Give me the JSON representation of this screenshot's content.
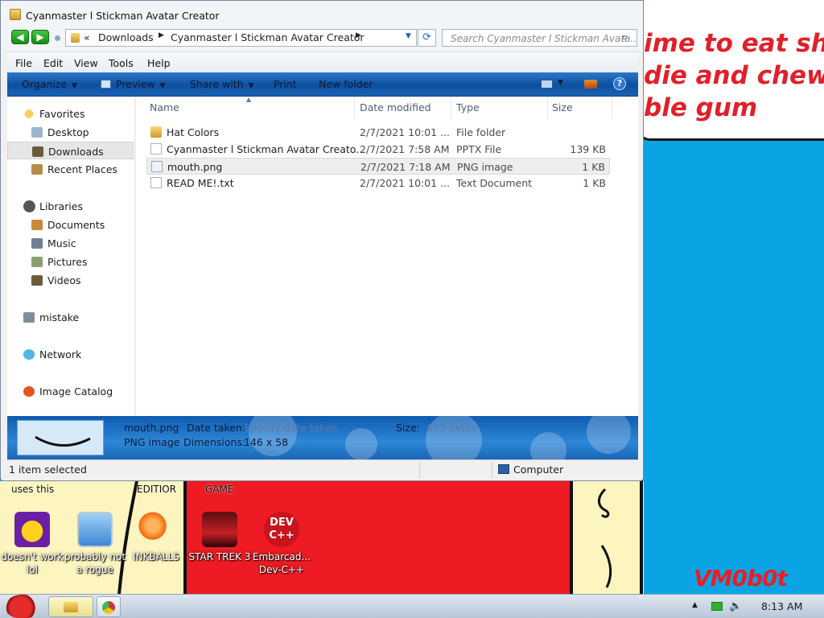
{
  "window": {
    "title": "Cyanmaster l Stickman Avatar Creator",
    "breadcrumb": [
      "Downloads",
      "Cyanmaster l Stickman Avatar Creator"
    ],
    "breadcrumb_prefix": "«",
    "search_placeholder": "Search Cyanmaster l Stickman Avata..."
  },
  "menubar": [
    "File",
    "Edit",
    "View",
    "Tools",
    "Help"
  ],
  "commandbar": {
    "organize": "Organize",
    "preview": "Preview",
    "share_with": "Share with",
    "print": "Print",
    "new_folder": "New folder"
  },
  "nav_pane": {
    "favorites": "Favorites",
    "desktop": "Desktop",
    "downloads": "Downloads",
    "recent_places": "Recent Places",
    "libraries": "Libraries",
    "documents": "Documents",
    "music": "Music",
    "pictures": "Pictures",
    "videos": "Videos",
    "mistake": "mistake",
    "network": "Network",
    "image_catalog": "Image Catalog"
  },
  "columns": {
    "name": "Name",
    "date_modified": "Date modified",
    "type": "Type",
    "size": "Size"
  },
  "files": [
    {
      "name": "Hat Colors",
      "date": "2/7/2021 10:01 ...",
      "type": "File folder",
      "size": ""
    },
    {
      "name": "Cyanmaster l Stickman Avatar Creato...",
      "date": "2/7/2021 7:58 AM",
      "type": "PPTX File",
      "size": "139 KB"
    },
    {
      "name": "mouth.png",
      "date": "2/7/2021 7:18 AM",
      "type": "PNG image",
      "size": "1 KB"
    },
    {
      "name": "READ ME!.txt",
      "date": "2/7/2021 10:01 ...",
      "type": "Text Document",
      "size": "1 KB"
    }
  ],
  "details": {
    "filename": "mouth.png",
    "date_taken_label": "Date taken:",
    "date_taken_value": "Specify date taken",
    "size_label": "Size:",
    "size_value": "633 bytes",
    "type": "PNG image",
    "dimensions_label": "Dimensions:",
    "dimensions_value": "146 x 58"
  },
  "status": {
    "selected": "1 item selected",
    "location": "Computer"
  },
  "wallpaper": {
    "speech": "ime to eat shit\ndie and chew\nble gum",
    "signature": "VM0b0t",
    "labels": [
      "uses this",
      "EDITIOR",
      "GAME"
    ]
  },
  "desktop_icons": [
    {
      "label": "doesn't work lol"
    },
    {
      "label": "probably not a rogue"
    },
    {
      "label": "INKBALLS"
    },
    {
      "label": "STAR TREK 3"
    },
    {
      "label": "Embarcad... Dev-C++"
    }
  ],
  "taskbar": {
    "clock": "8:13 AM",
    "tray_arrow": "▲"
  },
  "colors": {
    "wallpaper_blue": "#0aa4e4",
    "wallpaper_red": "#ee1b24",
    "wallpaper_cream": "#fdf5bf",
    "command_bar": "#1a62b4"
  }
}
